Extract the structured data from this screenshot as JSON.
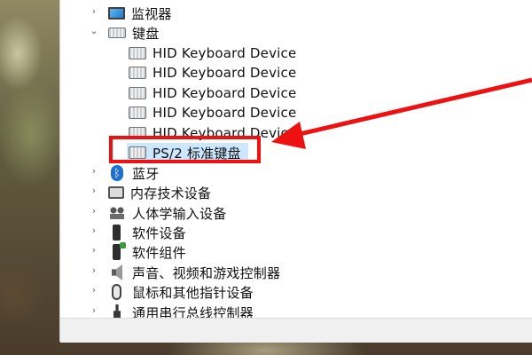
{
  "device_tree": {
    "items": [
      {
        "label": "监视器",
        "icon": "monitor-icon",
        "expanded": false,
        "indent": 0
      },
      {
        "label": "键盘",
        "icon": "keyboard-icon",
        "expanded": true,
        "indent": 0
      },
      {
        "label": "HID Keyboard Device",
        "icon": "keyboard-icon",
        "indent": 1
      },
      {
        "label": "HID Keyboard Device",
        "icon": "keyboard-icon",
        "indent": 1
      },
      {
        "label": "HID Keyboard Device",
        "icon": "keyboard-icon",
        "indent": 1
      },
      {
        "label": "HID Keyboard Device",
        "icon": "keyboard-icon",
        "indent": 1
      },
      {
        "label": "HID Keyboard Device",
        "icon": "keyboard-icon",
        "indent": 1
      },
      {
        "label": "PS/2 标准键盘",
        "icon": "keyboard-icon",
        "indent": 1,
        "selected": true
      },
      {
        "label": "蓝牙",
        "icon": "bluetooth-icon",
        "expanded": false,
        "indent": 0
      },
      {
        "label": "内存技术设备",
        "icon": "memory-device-icon",
        "expanded": false,
        "indent": 0
      },
      {
        "label": "人体学输入设备",
        "icon": "hid-icon",
        "expanded": false,
        "indent": 0
      },
      {
        "label": "软件设备",
        "icon": "software-device-icon",
        "expanded": false,
        "indent": 0
      },
      {
        "label": "软件组件",
        "icon": "software-component-icon",
        "expanded": false,
        "indent": 0
      },
      {
        "label": "声音、视频和游戏控制器",
        "icon": "speaker-icon",
        "expanded": false,
        "indent": 0
      },
      {
        "label": "鼠标和其他指针设备",
        "icon": "mouse-icon",
        "expanded": false,
        "indent": 0
      },
      {
        "label": "通用串行总线控制器",
        "icon": "usb-icon",
        "expanded": false,
        "indent": 0
      }
    ]
  },
  "chevrons": {
    "collapsed": "›",
    "expanded": "⌄"
  },
  "annotation": {
    "color": "#ee1111",
    "target": "PS/2 标准键盘"
  },
  "colors": {
    "selection": "#cce8ff",
    "window": "#ffffff"
  }
}
